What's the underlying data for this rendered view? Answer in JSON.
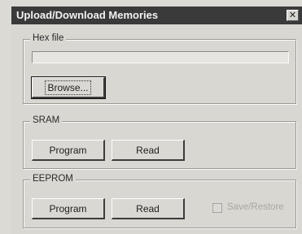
{
  "window": {
    "title": "Upload/Download Memories",
    "close_glyph": "✕",
    "close_icon": "close-icon"
  },
  "hex_file": {
    "label": "Hex file",
    "value": "",
    "browse_label": "Browse..."
  },
  "sram": {
    "label": "SRAM",
    "program_label": "Program",
    "read_label": "Read"
  },
  "eeprom": {
    "label": "EEPROM",
    "program_label": "Program",
    "read_label": "Read",
    "save_restore_label": "Save/Restore",
    "save_restore_checked": false,
    "save_restore_enabled": false
  }
}
